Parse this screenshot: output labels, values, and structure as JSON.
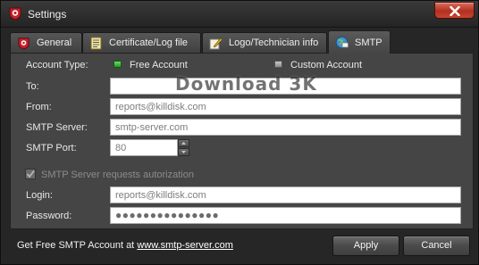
{
  "window": {
    "title": "Settings",
    "close_icon": "close-icon"
  },
  "tabs": [
    {
      "label": "General",
      "icon": "app-logo-icon",
      "active": false
    },
    {
      "label": "Certificate/Log file",
      "icon": "certificate-icon",
      "active": false
    },
    {
      "label": "Logo/Technician info",
      "icon": "pencil-note-icon",
      "active": false
    },
    {
      "label": "SMTP",
      "icon": "globe-mail-icon",
      "active": true
    }
  ],
  "smtp": {
    "account_type_label": "Account Type:",
    "options": [
      {
        "label": "Free Account",
        "selected": true,
        "color": "#2fb82f"
      },
      {
        "label": "Custom Account",
        "selected": false,
        "color": "#9a9a9a"
      }
    ],
    "to": {
      "label": "To:",
      "value": ""
    },
    "from": {
      "label": "From:",
      "value": "reports@killdisk.com"
    },
    "server": {
      "label": "SMTP Server:",
      "value": "smtp-server.com"
    },
    "port": {
      "label": "SMTP Port:",
      "value": "80"
    },
    "auth": {
      "label": "SMTP Server requests autorization",
      "checked": true,
      "disabled": true
    },
    "login": {
      "label": "Login:",
      "value": "reports@killdisk.com"
    },
    "password": {
      "label": "Password:",
      "value": "●●●●●●●●●●●●●●●"
    }
  },
  "watermark": "Download 3K",
  "footer": {
    "prefix": "Get Free SMTP Account at ",
    "link": "www.smtp-server.com",
    "apply_label": "Apply",
    "cancel_label": "Cancel"
  }
}
